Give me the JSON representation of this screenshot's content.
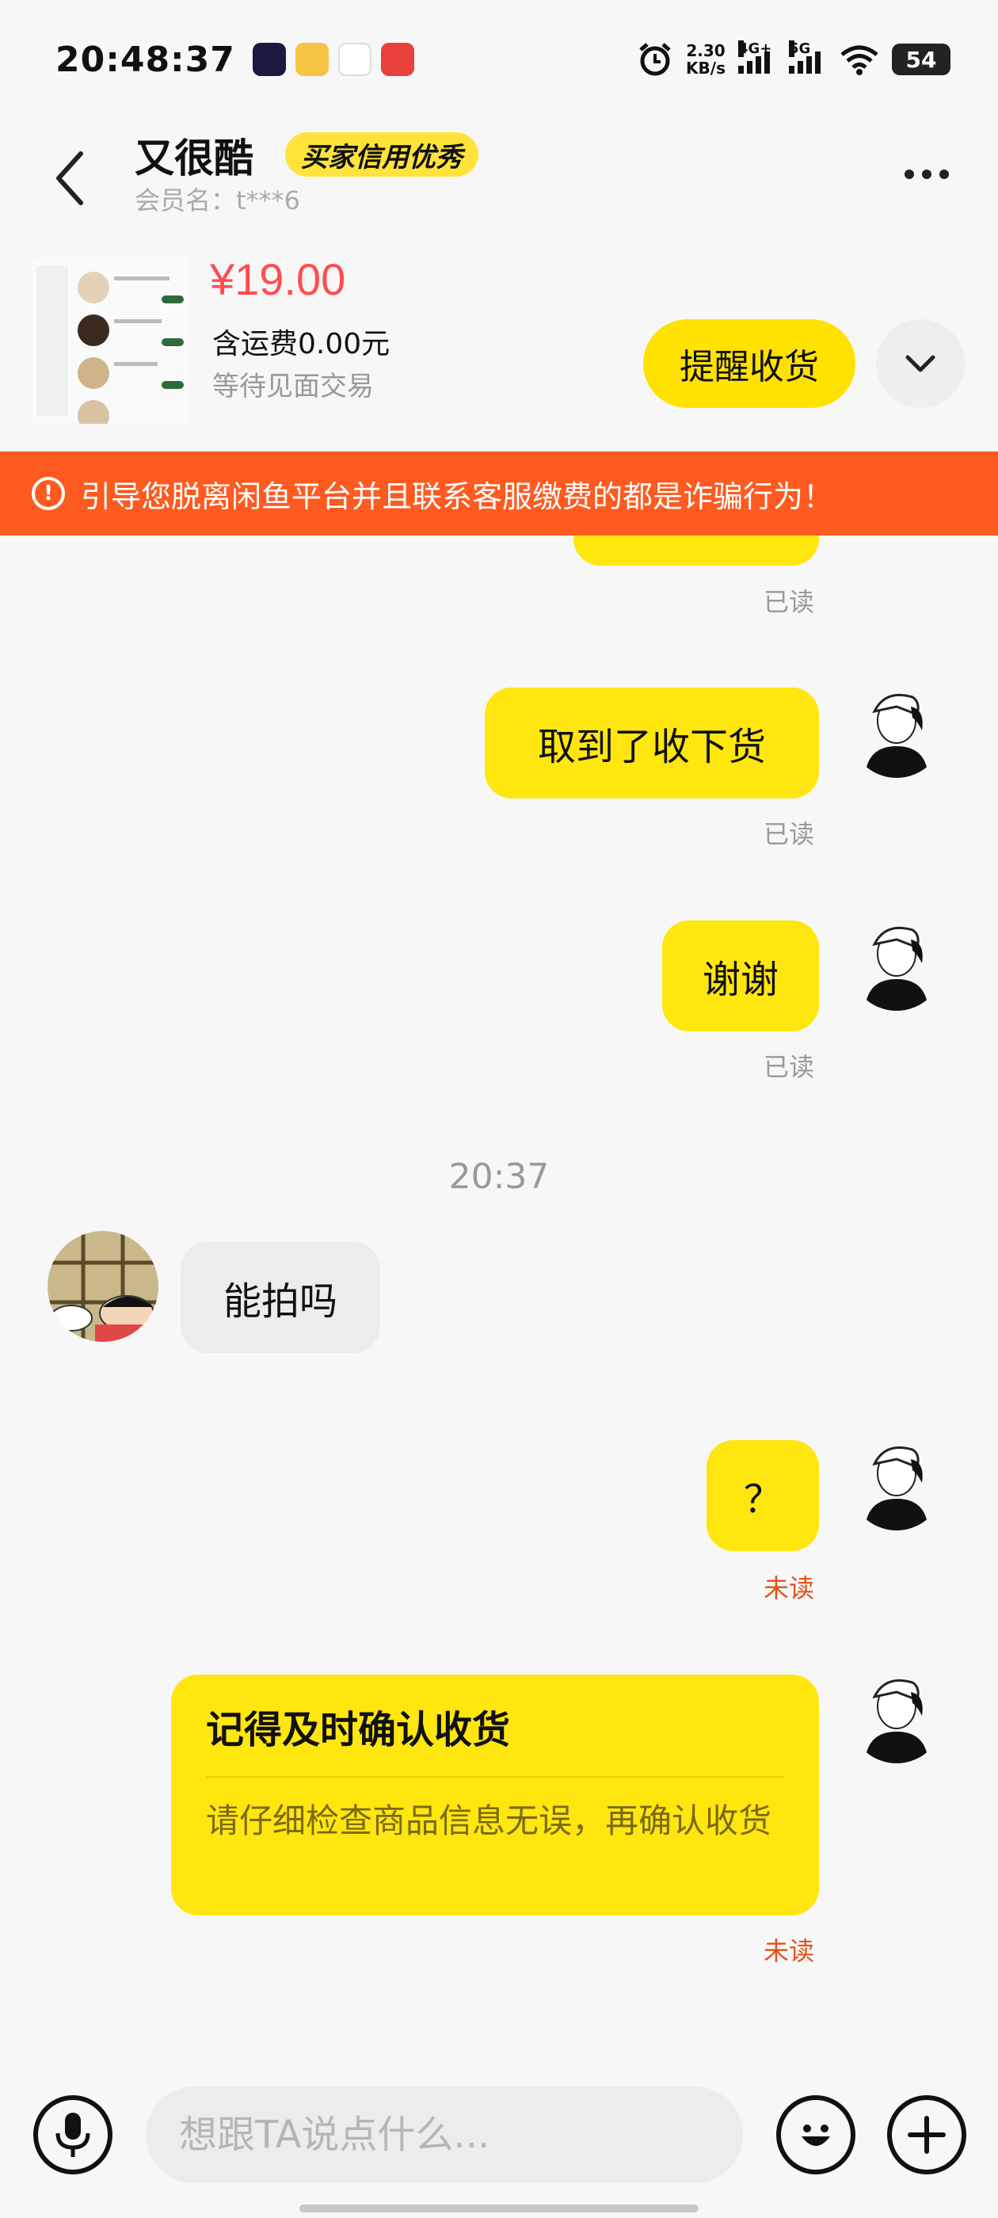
{
  "status_bar": {
    "time": "20:48:37",
    "net_speed_value": "2.30",
    "net_speed_unit": "KB/s",
    "signal1_label": "4G+",
    "signal2_label": "5G",
    "battery": "54"
  },
  "header": {
    "peer_name": "又很酷",
    "credit_badge": "买家信用优秀",
    "member_name": "会员名：t***6"
  },
  "product": {
    "price": "¥19.00",
    "shipping": "含运费0.00元",
    "trade_status": "等待见面交易",
    "remind_button": "提醒收货"
  },
  "warning": {
    "text": "引导您脱离闲鱼平台并且联系客服缴费的都是诈骗行为！"
  },
  "messages": {
    "m0_status": "已读",
    "m1_text": "取到了收下货",
    "m1_status": "已读",
    "m2_text": "谢谢",
    "m2_status": "已读",
    "timestamp": "20:37",
    "m3_text": "能拍吗",
    "m4_text": "？",
    "m4_status": "未读",
    "card_title": "记得及时确认收货",
    "card_body": "请仔细检查商品信息无误，再确认收货",
    "card_status": "未读"
  },
  "input": {
    "placeholder": "想跟TA说点什么..."
  },
  "colors": {
    "accent_yellow": "#ffe60f",
    "warning_orange": "#ff5a1f",
    "price_red": "#ff4d4f",
    "unread_orange": "#e2521b"
  }
}
